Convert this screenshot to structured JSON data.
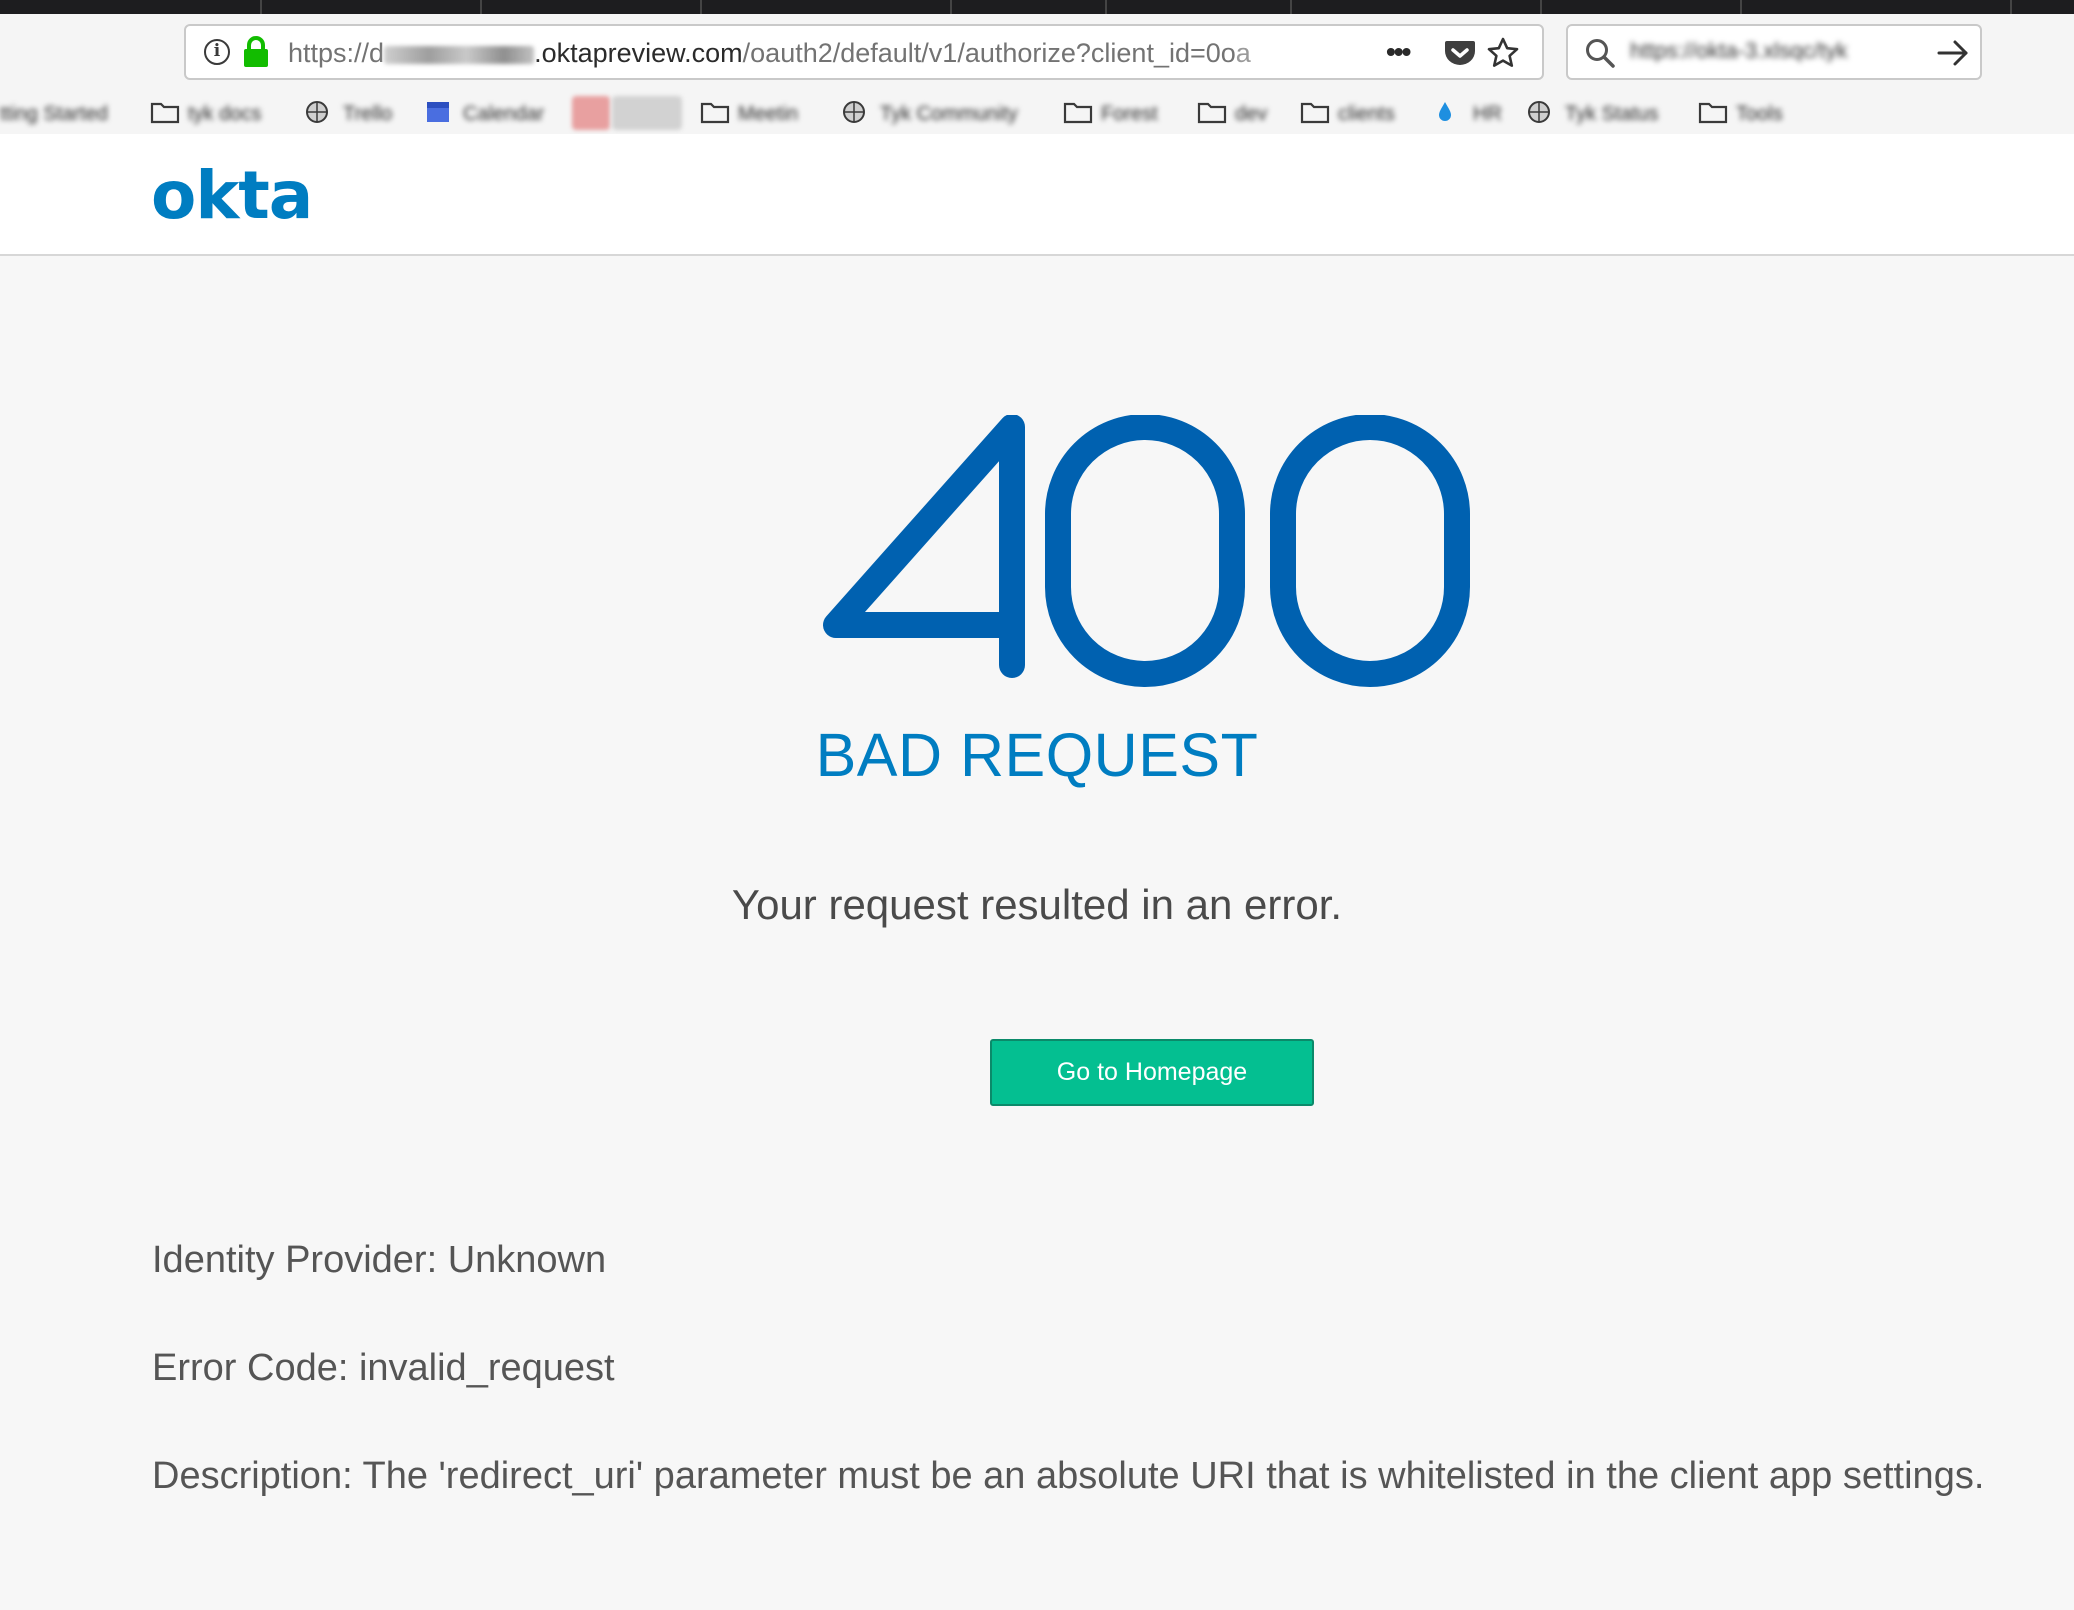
{
  "browser": {
    "url": {
      "scheme": "https://d",
      "host_suffix": ".oktapreview.com",
      "path": "/oauth2/default/v1/authorize?client_id=0o",
      "tail": "a"
    },
    "more_glyph": "•••",
    "search_text": "https://okta-3.xlsqc/tyk"
  },
  "bookmarks": [
    {
      "label": "tting Started",
      "icon": "none"
    },
    {
      "label": "tyk docs",
      "icon": "folder-icon"
    },
    {
      "label": "Trello",
      "icon": "globe-icon"
    },
    {
      "label": "Calendar",
      "icon": "calendar-icon"
    },
    {
      "label": "",
      "icon": "blurred-favicon"
    },
    {
      "label": "Meetin",
      "icon": "folder-icon"
    },
    {
      "label": "Tyk Community",
      "icon": "globe-icon"
    },
    {
      "label": "Forest",
      "icon": "folder-icon"
    },
    {
      "label": "dev",
      "icon": "folder-icon"
    },
    {
      "label": "clients",
      "icon": "folder-icon"
    },
    {
      "label": "HR",
      "icon": "drop-icon"
    },
    {
      "label": "Tyk Status",
      "icon": "globe-icon"
    },
    {
      "label": "Tools",
      "icon": "folder-icon"
    }
  ],
  "header": {
    "logo_text": "okta"
  },
  "error": {
    "code": "400",
    "title": "BAD REQUEST",
    "message": "Your request resulted in an error.",
    "button_label": "Go to Homepage",
    "details": [
      "Identity Provider: Unknown",
      "Error Code: invalid_request",
      "Description: The 'redirect_uri' parameter must be an absolute URI that is whitelisted in the client app settings."
    ]
  },
  "colors": {
    "brand_blue": "#007dc1",
    "code_blue": "#0061b0",
    "button_green": "#04bf91",
    "text_gray": "#555555",
    "page_bg": "#f7f7f7"
  }
}
